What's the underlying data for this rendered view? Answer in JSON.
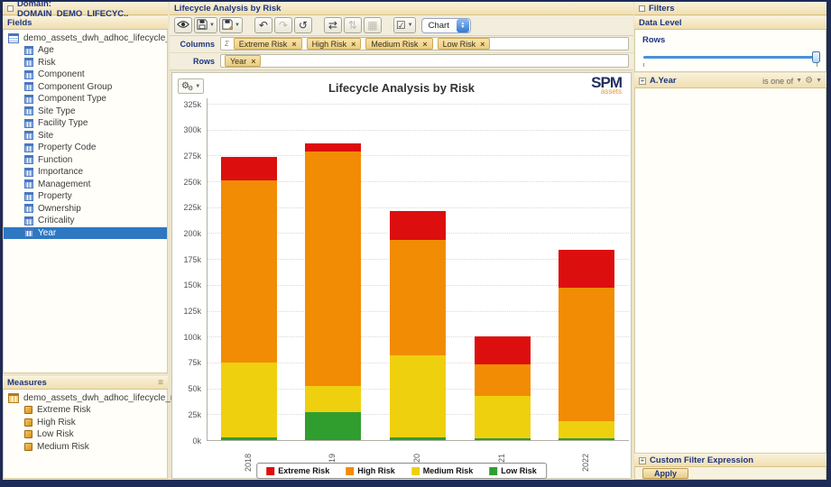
{
  "sidebar": {
    "domain_title": "Domain: DOMAIN_DEMO_LIFECYC..",
    "fields_header": "Fields",
    "fields_root": "demo_assets_dwh_adhoc_lifecycle_risk",
    "fields": [
      "Age",
      "Risk",
      "Component",
      "Component Group",
      "Component Type",
      "Site Type",
      "Facility Type",
      "Site",
      "Property Code",
      "Function",
      "Importance",
      "Management",
      "Property",
      "Ownership",
      "Criticality",
      "Year"
    ],
    "selected_field": "Year",
    "measures_header": "Measures",
    "measures_root": "demo_assets_dwh_adhoc_lifecycle_risk",
    "measures": [
      "Extreme Risk",
      "High Risk",
      "Low Risk",
      "Medium Risk"
    ]
  },
  "editor": {
    "title": "Lifecycle Analysis by Risk",
    "toolbar": {
      "view_mode_select": "Chart",
      "buttons": [
        {
          "name": "preview-button",
          "icon": "eye-icon",
          "glyph": "eye",
          "enabled": true,
          "dropdown": false,
          "group": 0
        },
        {
          "name": "save-button",
          "icon": "save-icon",
          "glyph": "floppy",
          "enabled": true,
          "dropdown": true,
          "group": 0
        },
        {
          "name": "export-button",
          "icon": "export-icon",
          "glyph": "floppy-pencil",
          "enabled": true,
          "dropdown": true,
          "group": 0
        },
        {
          "name": "undo-button",
          "icon": "undo-icon",
          "glyph": "↶",
          "enabled": true,
          "dropdown": false,
          "group": 1
        },
        {
          "name": "redo-button",
          "icon": "redo-icon",
          "glyph": "↷",
          "enabled": false,
          "dropdown": false,
          "group": 1
        },
        {
          "name": "undo-all-button",
          "icon": "revert-icon",
          "glyph": "↺",
          "enabled": true,
          "dropdown": false,
          "group": 1
        },
        {
          "name": "switch-groups-button",
          "icon": "switch-axes-icon",
          "glyph": "⇄",
          "enabled": true,
          "dropdown": false,
          "group": 2
        },
        {
          "name": "sort-button",
          "icon": "sort-icon",
          "glyph": "⇅",
          "enabled": false,
          "dropdown": false,
          "group": 2
        },
        {
          "name": "layout-grid-button",
          "icon": "grid-icon",
          "glyph": "▦",
          "enabled": false,
          "dropdown": false,
          "group": 2
        },
        {
          "name": "chart-options-button",
          "icon": "checkbox-icon",
          "glyph": "☑",
          "enabled": true,
          "dropdown": true,
          "group": 3
        }
      ]
    },
    "columns_label": "Columns",
    "rows_label": "Rows",
    "column_chips": [
      "Extreme Risk",
      "High Risk",
      "Medium Risk",
      "Low Risk"
    ],
    "row_chips": [
      "Year"
    ]
  },
  "logo": {
    "text": "SPM",
    "subtext": "assets"
  },
  "chart_data": {
    "type": "bar",
    "stacked": true,
    "title": "Lifecycle Analysis by Risk",
    "categories": [
      "2018",
      "2019",
      "2020",
      "2021",
      "2022"
    ],
    "series": [
      {
        "name": "Low Risk",
        "color": "#2f9e2f",
        "values": [
          3000,
          27000,
          3000,
          2000,
          2000
        ]
      },
      {
        "name": "Medium Risk",
        "color": "#efd00e",
        "values": [
          72000,
          25000,
          79000,
          41000,
          16000
        ]
      },
      {
        "name": "High Risk",
        "color": "#f18c04",
        "values": [
          176000,
          227000,
          111000,
          30000,
          129000
        ]
      },
      {
        "name": "Extreme Risk",
        "color": "#dd0e0e",
        "values": [
          23000,
          8000,
          28000,
          27000,
          37000
        ]
      }
    ],
    "legend_order": [
      "Extreme Risk",
      "High Risk",
      "Medium Risk",
      "Low Risk"
    ],
    "xlabel": "",
    "ylabel": "",
    "ylim": [
      0,
      325000
    ],
    "ytick_step": 25000,
    "ytick_format": "k",
    "grid": true,
    "legend_position": "bottom"
  },
  "filters": {
    "header": "Filters",
    "data_level_header": "Data Level",
    "rows_label": "Rows",
    "field_filter": {
      "name": "A.Year",
      "operator": "is one of"
    },
    "custom_filter_header": "Custom Filter Expression",
    "apply_label": "Apply"
  }
}
